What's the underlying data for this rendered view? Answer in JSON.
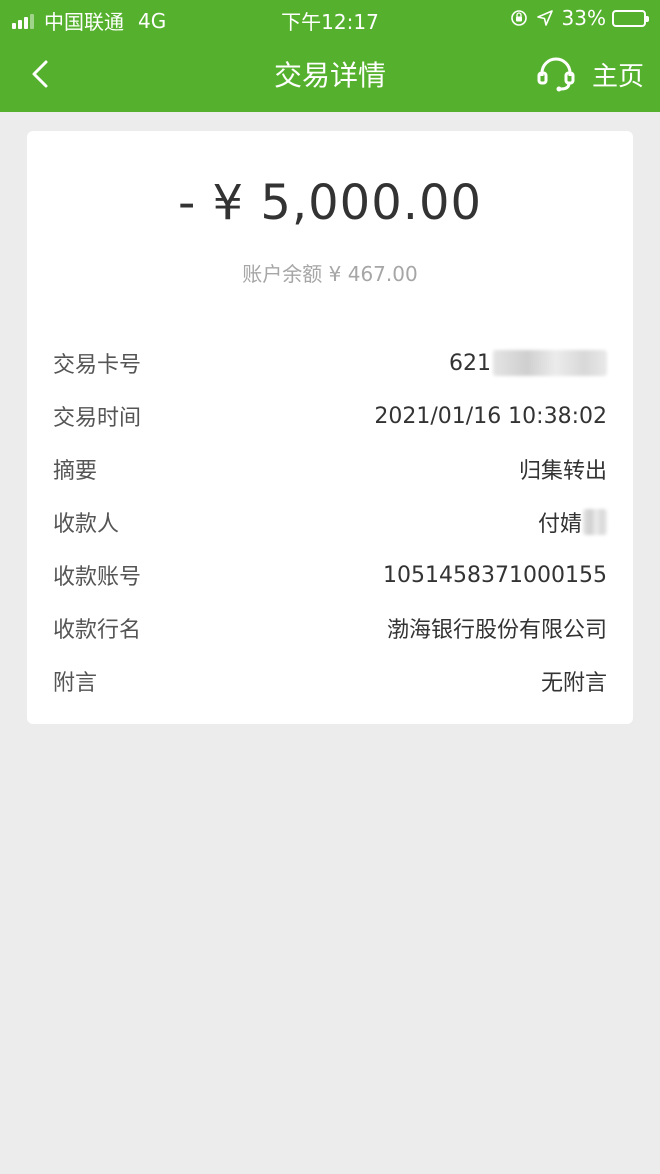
{
  "status_bar": {
    "carrier": "中国联通",
    "network": "4G",
    "time": "下午12:17",
    "battery": "33%",
    "battery_level": 0.33
  },
  "nav": {
    "title": "交易详情",
    "home_label": "主页",
    "back_icon": "chevron-left-icon",
    "service_icon": "headset-icon"
  },
  "transaction": {
    "amount": "- ¥ 5,000.00",
    "balance": "账户余额 ¥ 467.00",
    "rows": [
      {
        "label": "交易卡号",
        "value": "621"
      },
      {
        "label": "交易时间",
        "value": "2021/01/16 10:38:02"
      },
      {
        "label": "摘要",
        "value": "归集转出"
      },
      {
        "label": "收款人",
        "value": "付婧"
      },
      {
        "label": "收款账号",
        "value": "1051458371000155"
      },
      {
        "label": "收款行名",
        "value": "渤海银行股份有限公司"
      },
      {
        "label": "附言",
        "value": "无附言"
      }
    ]
  },
  "colors": {
    "header_green": "#55b12d",
    "background": "#ececec",
    "card": "#ffffff"
  }
}
